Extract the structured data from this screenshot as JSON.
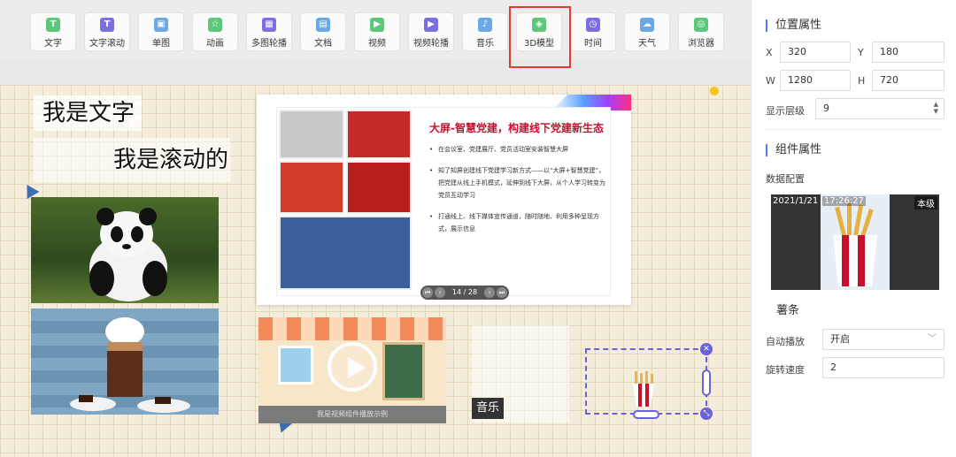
{
  "toolbar": {
    "items": [
      {
        "label": "文字",
        "glyph": "T",
        "color": "#5cc97a"
      },
      {
        "label": "文字滚动",
        "glyph": "T",
        "color": "#7b6fe0"
      },
      {
        "label": "单图",
        "glyph": "▣",
        "color": "#6aa8e6"
      },
      {
        "label": "动画",
        "glyph": "☆",
        "color": "#5cc97a"
      },
      {
        "label": "多图轮播",
        "glyph": "▦",
        "color": "#7b6fe0"
      },
      {
        "label": "文档",
        "glyph": "▤",
        "color": "#6aa8e6"
      },
      {
        "label": "视频",
        "glyph": "▶",
        "color": "#5cc97a"
      },
      {
        "label": "视频轮播",
        "glyph": "▶",
        "color": "#7b6fe0"
      },
      {
        "label": "音乐",
        "glyph": "♪",
        "color": "#6aa8e6"
      },
      {
        "label": "3D模型",
        "glyph": "◈",
        "color": "#5cc97a"
      },
      {
        "label": "时间",
        "glyph": "◷",
        "color": "#7b6fe0"
      },
      {
        "label": "天气",
        "glyph": "☁",
        "color": "#6aa8e6"
      },
      {
        "label": "浏览器",
        "glyph": "◎",
        "color": "#5cc97a"
      }
    ]
  },
  "canvas": {
    "text1": "我是文字",
    "text2": "我是滚动的",
    "slide": {
      "title": "大屏-智慧党建，构建线下党建新生态",
      "bullets": [
        "在会议室、党建展厅、党员活动室安装智慧大屏",
        "知了知屏创建线下党建学习新方式——以“大屏+智慧党建”，把党建从线上手机模式，延伸到线下大屏，从个人学习转变为党员互动学习",
        "打通线上、线下媒体宣传通道，随时随地、利用多种呈现方式，展示信息"
      ],
      "pager": "14 / 28"
    },
    "video_caption": "我是视频组件播放示例",
    "music_label": "音乐"
  },
  "panel": {
    "position_title": "位置属性",
    "x_label": "X",
    "x_value": "320",
    "y_label": "Y",
    "y_value": "180",
    "w_label": "W",
    "w_value": "1280",
    "h_label": "H",
    "h_value": "720",
    "layer_label": "显示层级",
    "layer_value": "9",
    "component_title": "组件属性",
    "data_config_label": "数据配置",
    "preview_date": "2021/1/21",
    "preview_time": "17:26:27",
    "preview_badge": "本级",
    "item_name": "薯条",
    "autoplay_label": "自动播放",
    "autoplay_value": "开启",
    "rotate_label": "旋转速度",
    "rotate_value": "2"
  }
}
